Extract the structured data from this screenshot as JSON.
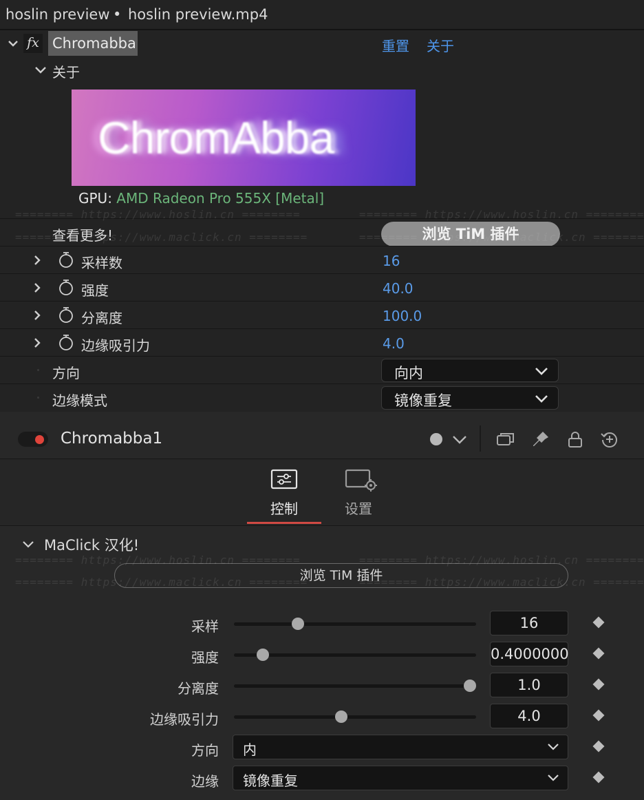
{
  "title_bar": {
    "left": "hoslin preview",
    "sep": "•",
    "right": "hoslin preview.mp4"
  },
  "effect": {
    "fx_icon": "fx",
    "name": "Chromabba",
    "reset": "重置",
    "about": "关于"
  },
  "about_group": {
    "label": "关于",
    "banner_text": "ChromAbba",
    "gpu_label": "GPU:",
    "gpu_value": "AMD Radeon Pro 555X [Metal]"
  },
  "see_more": {
    "label": "查看更多!",
    "button": "浏览 TiM 插件"
  },
  "params": [
    {
      "label": "采样数",
      "value": "16"
    },
    {
      "label": "强度",
      "value": "40.0"
    },
    {
      "label": "分离度",
      "value": "100.0"
    },
    {
      "label": "边缘吸引力",
      "value": "4.0"
    }
  ],
  "direction": {
    "label": "方向",
    "value": "向内"
  },
  "edge_mode": {
    "label": "边缘模式",
    "value": "镜像重复"
  },
  "watermarks": {
    "hoslin": "======== https://www.hoslin.cn ========",
    "maclick": "======== https://www.maclick.cn ========"
  },
  "node": {
    "name": "Chromabba1"
  },
  "tabs": [
    {
      "label": "控制",
      "icon": "sliders-icon"
    },
    {
      "label": "设置",
      "icon": "settings-icon"
    }
  ],
  "controls_section": {
    "title": "MaClick 汉化!",
    "button": "浏览 TiM 插件"
  },
  "sliders": [
    {
      "label": "采样",
      "value": "16",
      "level": 0.25
    },
    {
      "label": "强度",
      "value": "0.4000000",
      "level": 0.1
    },
    {
      "label": "分离度",
      "value": "1.0",
      "level": 1.0
    },
    {
      "label": "边缘吸引力",
      "value": "4.0",
      "level": 0.44
    }
  ],
  "rs_direction": {
    "label": "方向",
    "value": "内"
  },
  "rs_edge": {
    "label": "边缘",
    "value": "镜像重复"
  },
  "colors": {
    "accent_blue": "#5a9be8",
    "gpu_green": "#6bb57a",
    "active_tab": "#d04a44",
    "toggle_red": "#e0443b"
  }
}
